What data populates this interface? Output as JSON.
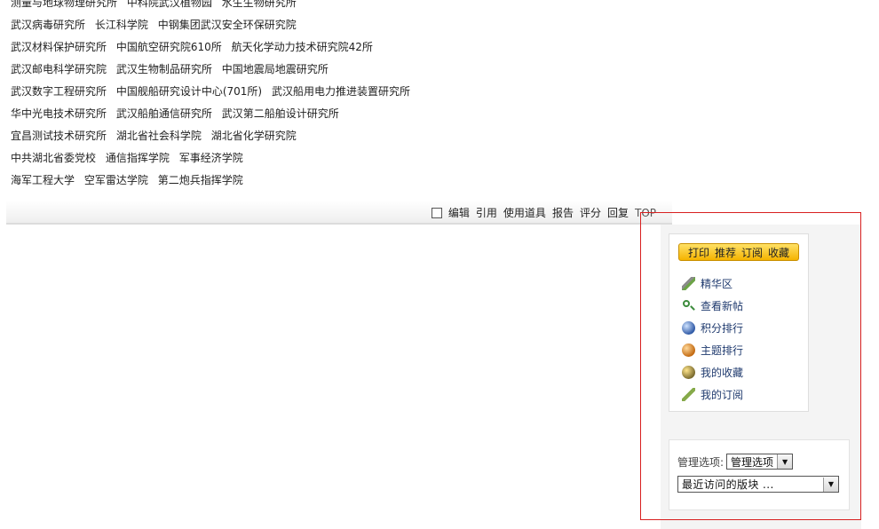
{
  "post": {
    "lines": [
      [
        "测量与地球物理研究所",
        "中科院武汉植物园",
        "水生生物研究所"
      ],
      [
        "武汉病毒研究所",
        "长江科学院",
        "中钢集团武汉安全环保研究院"
      ],
      [
        "武汉材料保护研究所",
        "中国航空研究院610所",
        "航天化学动力技术研究院42所"
      ],
      [
        "武汉邮电科学研究院",
        "武汉生物制品研究所",
        "中国地震局地震研究所"
      ],
      [
        "武汉数字工程研究所",
        "中国舰船研究设计中心(701所)",
        "武汉船用电力推进装置研究所"
      ],
      [
        "华中光电技术研究所",
        "武汉船舶通信研究所",
        "武汉第二船舶设计研究所"
      ],
      [
        "宜昌测试技术研究所",
        "湖北省社会科学院",
        "湖北省化学研究院"
      ],
      [
        "中共湖北省委党校",
        "通信指挥学院",
        "军事经济学院"
      ],
      [
        "海军工程大学",
        "空军雷达学院",
        "第二炮兵指挥学院"
      ]
    ]
  },
  "postbar": {
    "edit": "编辑",
    "quote": "引用",
    "use_tool": "使用道具",
    "report": "报告",
    "rate": "评分",
    "reply": "回复",
    "top": "TOP"
  },
  "panel": {
    "print": "打印",
    "recommend": "推荐",
    "subscribe": "订阅",
    "collect": "收藏",
    "menu": [
      {
        "label": "精华区",
        "icon": "pen-icon"
      },
      {
        "label": "查看新帖",
        "icon": "search-icon"
      },
      {
        "label": "积分排行",
        "icon": "rank-icon"
      },
      {
        "label": "主题排行",
        "icon": "topic-icon"
      },
      {
        "label": "我的收藏",
        "icon": "favorite-icon"
      },
      {
        "label": "我的订阅",
        "icon": "feather-icon"
      }
    ]
  },
  "manage": {
    "label": "管理选项:",
    "select_value": "管理选项",
    "recent_value": "最近访问的版块 ..."
  },
  "colors": {
    "highlight": "#d82020",
    "button_bg": "#f5b300",
    "link": "#1f3a6e"
  }
}
